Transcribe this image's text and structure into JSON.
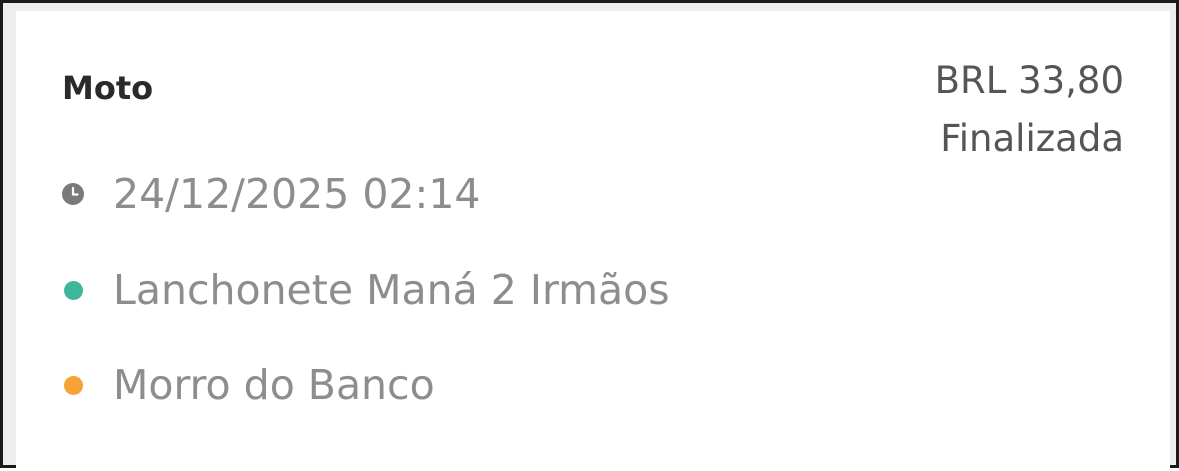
{
  "ride": {
    "vehicle_type": "Moto",
    "price": "BRL 33,80",
    "status": "Finalizada",
    "datetime": "24/12/2025 02:14",
    "pickup": "Lanchonete Maná 2 Irmãos",
    "dropoff": "Morro do Banco"
  },
  "icons": {
    "datetime": "clock-icon",
    "pickup": "pickup-dot-icon",
    "dropoff": "dropoff-dot-icon"
  },
  "colors": {
    "pickup_dot": "#3fb59e",
    "dropoff_dot": "#f7a136",
    "clock": "#7a7a7a"
  }
}
